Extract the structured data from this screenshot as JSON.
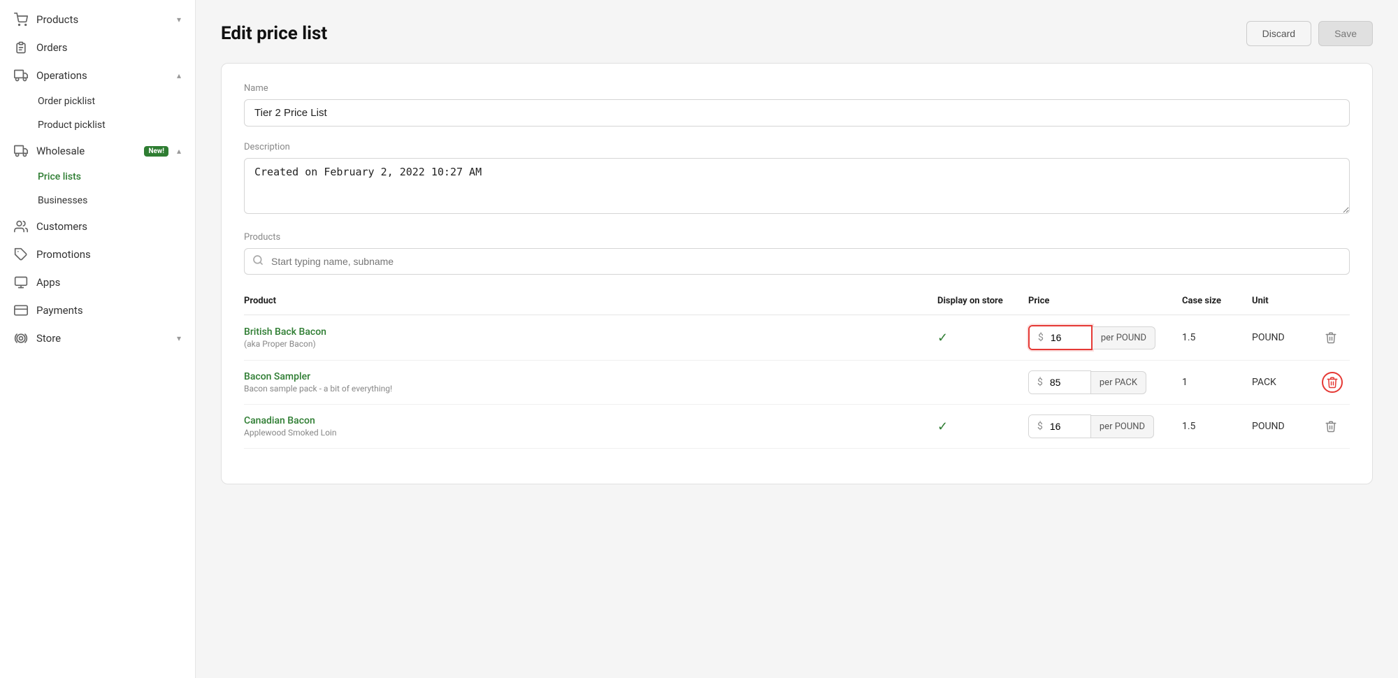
{
  "sidebar": {
    "items": [
      {
        "id": "products",
        "label": "Products",
        "icon": "🛒",
        "hasChevron": true,
        "expanded": false
      },
      {
        "id": "orders",
        "label": "Orders",
        "icon": "📋",
        "hasChevron": false
      },
      {
        "id": "operations",
        "label": "Operations",
        "icon": "🚌",
        "hasChevron": true,
        "expanded": true
      },
      {
        "id": "order-picklist",
        "label": "Order picklist",
        "isSubItem": true
      },
      {
        "id": "product-picklist",
        "label": "Product picklist",
        "isSubItem": true
      },
      {
        "id": "wholesale",
        "label": "Wholesale",
        "icon": "🚚",
        "hasChevron": true,
        "expanded": true,
        "badge": "New!"
      },
      {
        "id": "price-lists",
        "label": "Price lists",
        "isSubItem": true,
        "isActive": true
      },
      {
        "id": "businesses",
        "label": "Businesses",
        "isSubItem": true
      },
      {
        "id": "customers",
        "label": "Customers",
        "icon": "👥",
        "hasChevron": false
      },
      {
        "id": "promotions",
        "label": "Promotions",
        "icon": "🏷",
        "hasChevron": false
      },
      {
        "id": "apps",
        "label": "Apps",
        "icon": "🖥",
        "hasChevron": false
      },
      {
        "id": "payments",
        "label": "Payments",
        "icon": "💳",
        "hasChevron": false
      },
      {
        "id": "store",
        "label": "Store",
        "icon": "⚙",
        "hasChevron": true,
        "expanded": false
      }
    ]
  },
  "page": {
    "title": "Edit price list",
    "discard_label": "Discard",
    "save_label": "Save"
  },
  "form": {
    "name_label": "Name",
    "name_value": "Tier 2 Price List",
    "description_label": "Description",
    "description_value": "Created on February 2, 2022 10:27 AM",
    "products_label": "Products",
    "search_placeholder": "Start typing name, subname"
  },
  "table": {
    "col_product": "Product",
    "col_display": "Display on store",
    "col_price": "Price",
    "col_casesize": "Case size",
    "col_unit": "Unit",
    "rows": [
      {
        "name": "British Back Bacon",
        "sub": "(aka Proper Bacon)",
        "display_on_store": true,
        "price": "16",
        "per": "per POUND",
        "case_size": "1.5",
        "unit": "POUND",
        "highlighted_price": true,
        "highlighted_delete": false
      },
      {
        "name": "Bacon Sampler",
        "sub": "Bacon sample pack - a bit of everything!",
        "display_on_store": false,
        "price": "85",
        "per": "per PACK",
        "case_size": "1",
        "unit": "PACK",
        "highlighted_price": false,
        "highlighted_delete": true
      },
      {
        "name": "Canadian Bacon",
        "sub": "Applewood Smoked Loin",
        "display_on_store": true,
        "price": "16",
        "per": "per POUND",
        "case_size": "1.5",
        "unit": "POUND",
        "highlighted_price": false,
        "highlighted_delete": false
      }
    ]
  }
}
